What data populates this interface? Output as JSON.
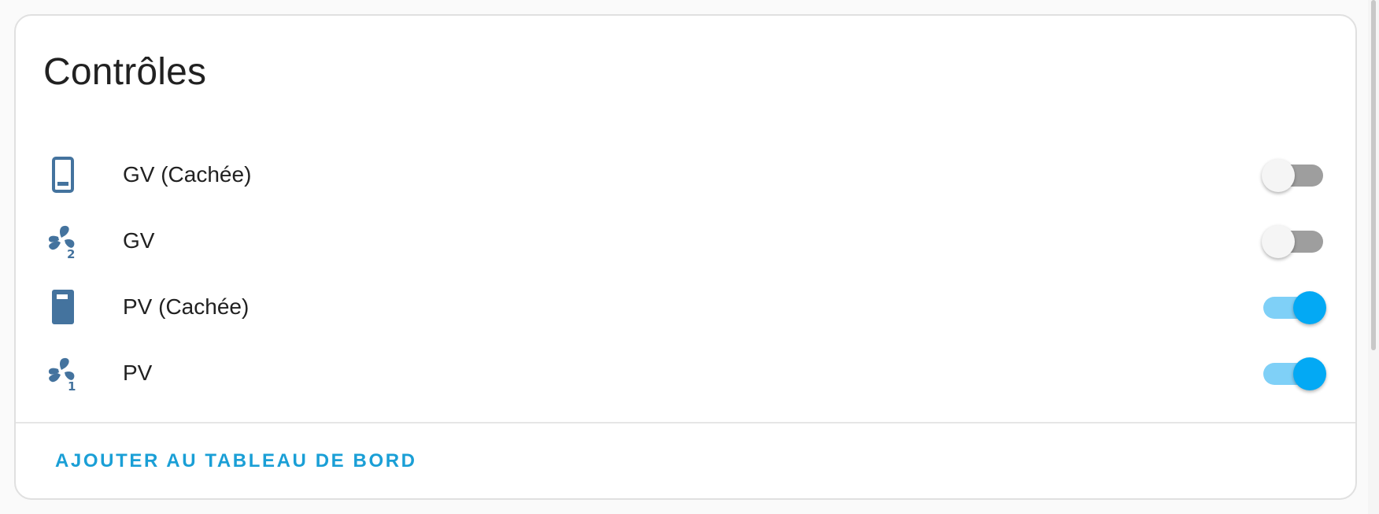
{
  "card": {
    "title": "Contrôles",
    "action_label": "AJOUTER AU TABLEAU DE BORD"
  },
  "rows": [
    {
      "label": "GV (Cachée)",
      "icon": "phone-outline-icon",
      "state": "off"
    },
    {
      "label": "GV",
      "icon": "fan-speed-2-icon",
      "state": "off"
    },
    {
      "label": "PV (Cachée)",
      "icon": "phone-filled-icon",
      "state": "on"
    },
    {
      "label": "PV",
      "icon": "fan-speed-1-icon",
      "state": "on"
    }
  ],
  "colors": {
    "icon": "#44739e",
    "accent": "#03a9f4",
    "action_text": "#1a9fd6",
    "toggle_off_track": "#9e9e9e"
  }
}
